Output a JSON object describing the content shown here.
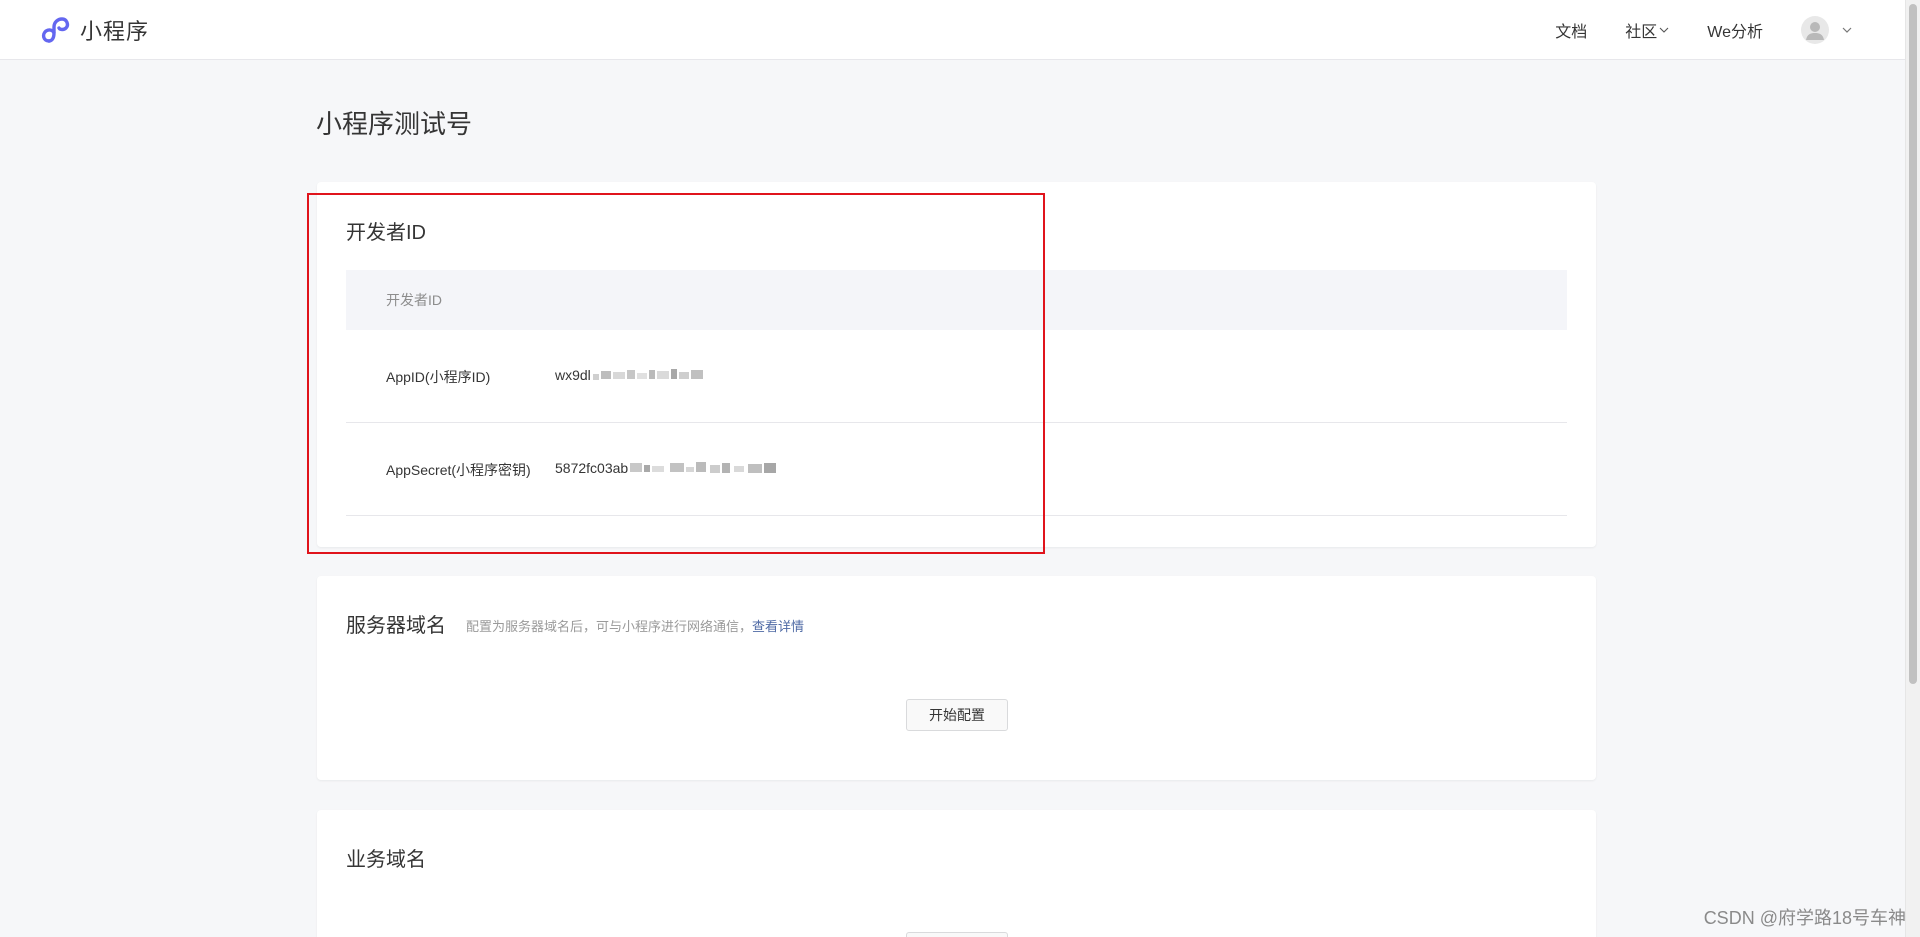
{
  "topbar": {
    "brand_name": "小程序",
    "brand_icon": "miniprogram-logo-icon",
    "nav": {
      "docs": "文档",
      "community": "社区",
      "analytics": "We分析"
    },
    "brand_color": "#6467f0"
  },
  "page": {
    "title": "小程序测试号"
  },
  "developer_id": {
    "section_title": "开发者ID",
    "table_header": "开发者ID",
    "rows": [
      {
        "label": "AppID(小程序ID)",
        "value": "wx9dl"
      },
      {
        "label": "AppSecret(小程序密钥)",
        "value": "5872fc03ab"
      }
    ],
    "highlight_color": "#e0141c"
  },
  "server_domain": {
    "section_title": "服务器域名",
    "description": "配置为服务器域名后，可与小程序进行网络通信，",
    "link": "查看详情",
    "button_label": "开始配置"
  },
  "business_domain": {
    "section_title": "业务域名"
  },
  "watermark": "CSDN @府学路18号车神"
}
